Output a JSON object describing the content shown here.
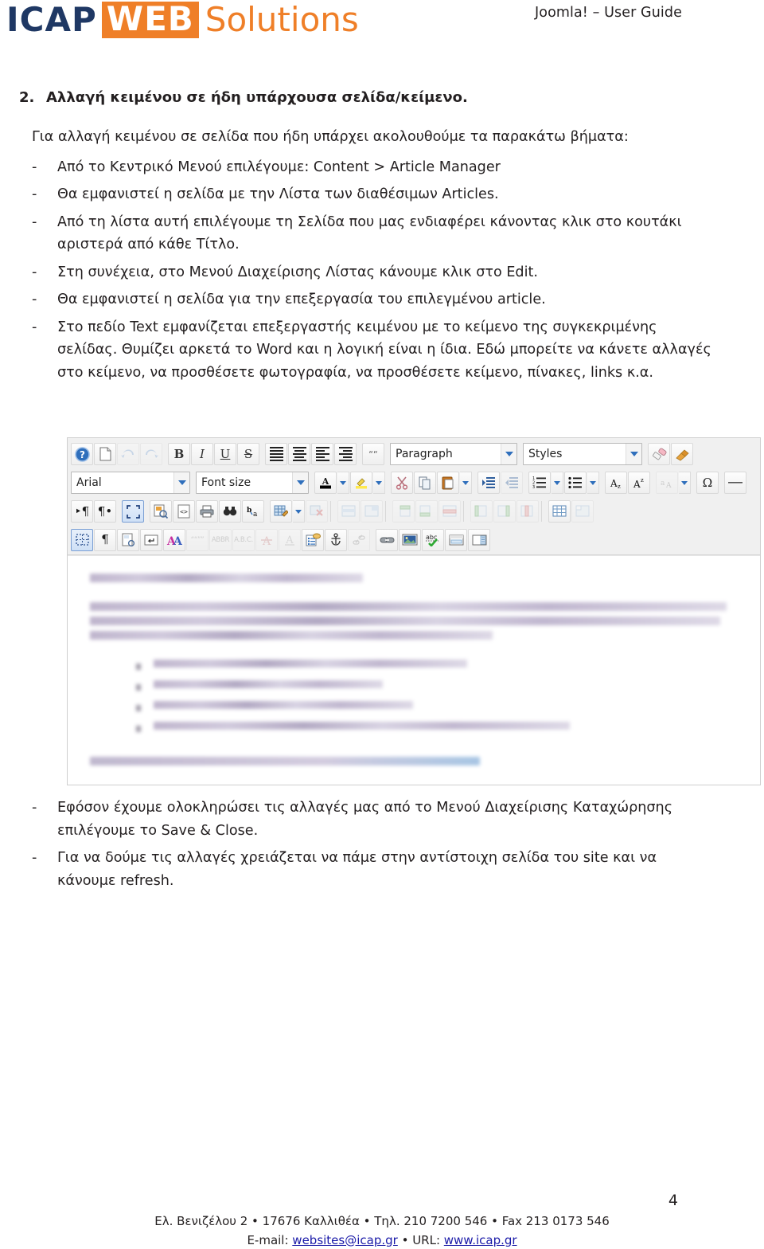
{
  "header": {
    "logo": {
      "icap": "ICAP",
      "web": "WEB",
      "solutions": "Solutions"
    },
    "doc_title": "Joomla! – User Guide"
  },
  "section": {
    "number": "2.",
    "title": "Αλλαγή κειμένου σε ήδη υπάρχουσα σελίδα/κείμενο."
  },
  "body": {
    "intro": "Για αλλαγή κειμένου σε σελίδα που ήδη υπάρχει ακολουθούμε τα παρακάτω βήματα:",
    "bullet_marker": "-",
    "steps_before": [
      "Από το Κεντρικό Μενού επιλέγουμε: Content > Article Manager",
      "Θα εμφανιστεί η σελίδα με την Λίστα των διαθέσιμων Articles.",
      "Από τη λίστα αυτή επιλέγουμε τη Σελίδα που μας ενδιαφέρει κάνοντας κλικ στο κουτάκι αριστερά από κάθε Τίτλο.",
      "Στη συνέχεια, στο Μενού Διαχείρισης Λίστας κάνουμε κλικ στο Edit.",
      "Θα εμφανιστεί η σελίδα για την επεξεργασία του επιλεγμένου article.",
      "Στο πεδίο Text εμφανίζεται επεξεργαστής κειμένου με το κείμενο της συγκεκριμένης σελίδας. Θυμίζει αρκετά το Word και η λογική είναι η ίδια. Εδώ μπορείτε να κάνετε αλλαγές στο κείμενο, να προσθέσετε φωτογραφία, να προσθέσετε κείμενο, πίνακες, links κ.α."
    ],
    "steps_after": [
      "Εφόσον έχουμε ολοκληρώσει τις αλλαγές μας από το Μενού Διαχείρισης Καταχώρησης επιλέγουμε το Save & Close.",
      "Για να δούμε τις αλλαγές χρειάζεται να πάμε στην αντίστοιχη σελίδα του site και να κάνουμε refresh."
    ]
  },
  "editor": {
    "combos": {
      "font_family": "Arial",
      "font_size": "Font size",
      "paragraph_format": "Paragraph",
      "styles": "Styles"
    },
    "row1_icons": [
      "help-icon",
      "new-document-icon",
      "undo-icon",
      "redo-icon",
      "bold-icon",
      "italic-icon",
      "underline-icon",
      "strikethrough-icon",
      "align-justify-icon",
      "align-center-icon",
      "align-left-icon",
      "align-right-icon",
      "blockquote-icon"
    ],
    "row1_end_icons": [
      "eraser-icon",
      "format-painter-icon"
    ],
    "row2_icons": [
      "text-color-icon",
      "highlight-color-icon",
      "cut-icon",
      "copy-icon",
      "paste-icon",
      "indent-increase-icon",
      "indent-decrease-icon",
      "numbered-list-icon",
      "bulleted-list-icon",
      "subscript-icon",
      "superscript-icon",
      "anchor-link-icon",
      "special-character-icon",
      "horizontal-rule-icon"
    ],
    "row3_icons": [
      "paragraph-ltr-icon",
      "paragraph-rtl-icon",
      "fullscreen-icon",
      "preview-icon",
      "source-code-icon",
      "print-icon",
      "find-icon",
      "find-replace-icon",
      "insert-table-icon",
      "delete-table-icon",
      "table-row-props-icon",
      "table-cell-props-icon",
      "insert-row-before-icon",
      "insert-row-after-icon",
      "delete-row-icon",
      "insert-column-before-icon",
      "insert-column-after-icon",
      "delete-column-icon",
      "merge-cells-icon",
      "split-cells-icon"
    ],
    "row4_icons": [
      "show-guidelines-icon",
      "show-invisibles-icon",
      "page-break-icon",
      "line-break-icon",
      "font-style-icon",
      "quote-icon",
      "abbreviation-icon",
      "acronym-icon",
      "remove-format-icon",
      "underline-style-icon",
      "template-icon",
      "anchor-icon",
      "unlink-icon",
      "link-icon",
      "insert-image-icon",
      "spellcheck-icon",
      "insert-layer-icon",
      "insert-iframe-icon"
    ],
    "caption_note": "blurred article editor content"
  },
  "footer": {
    "page_number": "4",
    "line1": "Ελ. Βενιζέλου 2 • 17676 Καλλιθέα • Τηλ. 210 7200 546 • Fax 213 0173 546",
    "line2_prefix": "E-mail: ",
    "email": "websites@icap.gr",
    "line2_middle": " • URL: ",
    "url": "www.icap.gr"
  },
  "colors": {
    "brand_navy": "#1f3864",
    "brand_orange": "#ef7f28",
    "text": "#231f20",
    "link": "#1a1aa8"
  }
}
